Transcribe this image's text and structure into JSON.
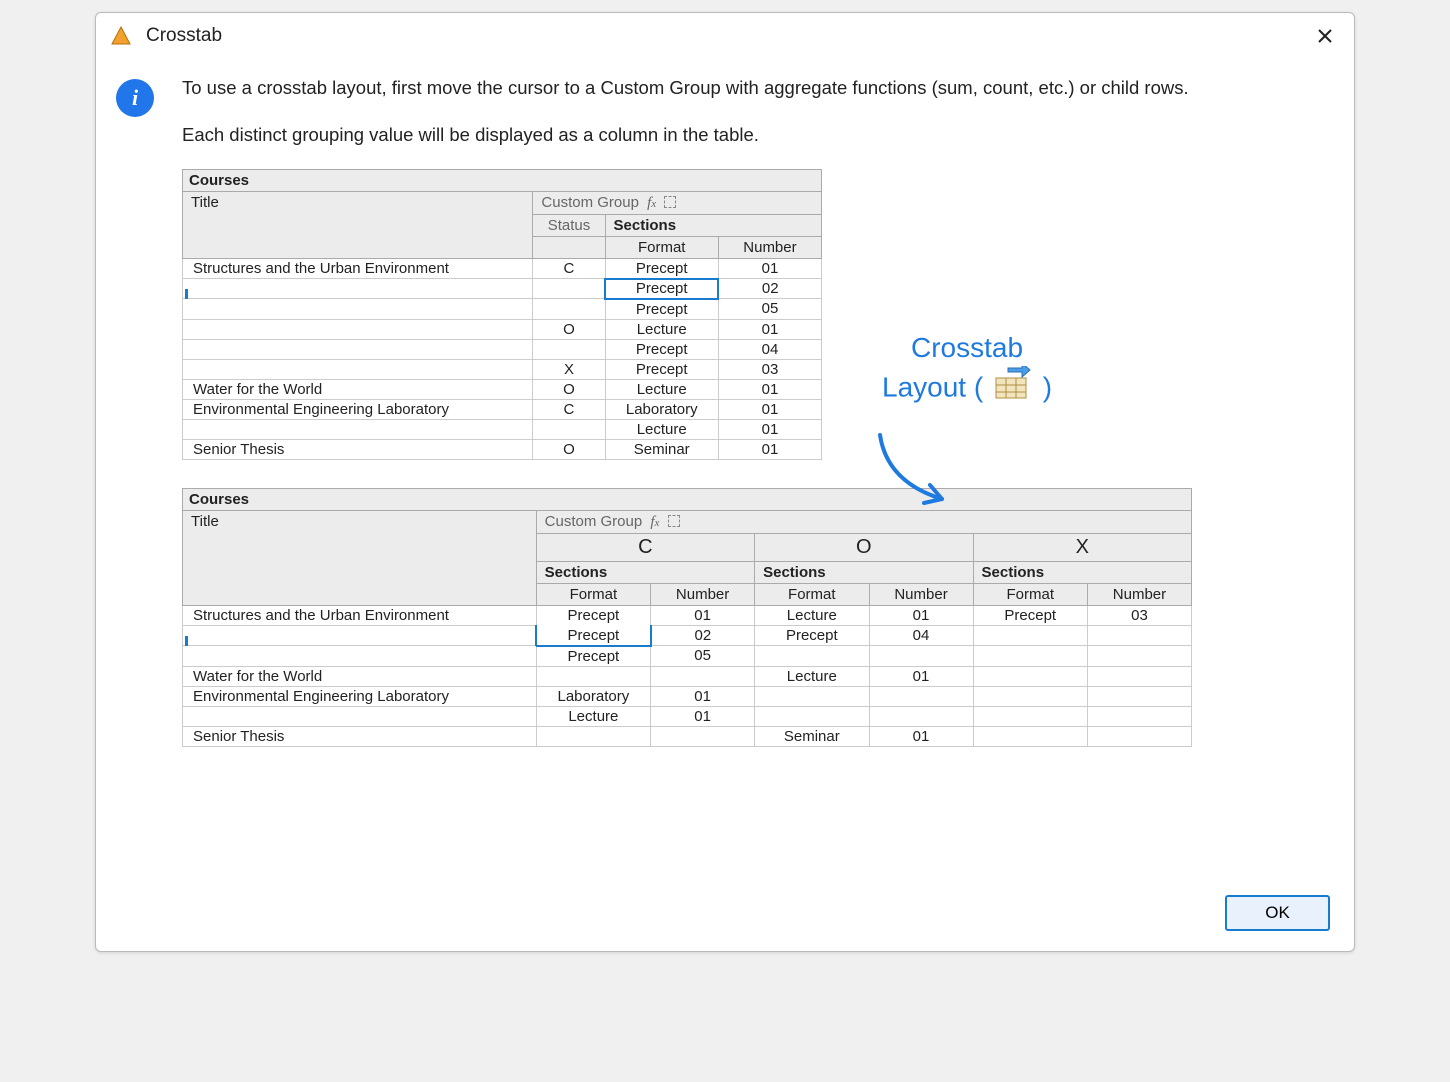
{
  "title": "Crosstab",
  "para1": "To use a crosstab layout, first move the cursor to a Custom Group with aggregate functions (sum, count, etc.) or child rows.",
  "para2": "Each distinct grouping value will be displayed as a column in the table.",
  "annotation": {
    "line1": "Crosstab",
    "line2_a": "Layout (",
    "line2_b": ")"
  },
  "ok_label": "OK",
  "table1": {
    "courses": "Courses",
    "title_hdr": "Title",
    "custom_group": "Custom Group",
    "status": "Status",
    "sections": "Sections",
    "format": "Format",
    "number": "Number",
    "rows": [
      {
        "title": "Structures and the Urban Environment",
        "status": "C",
        "format": "Precept",
        "number": "01"
      },
      {
        "title": "",
        "status": "",
        "format": "Precept",
        "number": "02",
        "sel": true
      },
      {
        "title": "",
        "status": "",
        "format": "Precept",
        "number": "05"
      },
      {
        "title": "",
        "status": "O",
        "format": "Lecture",
        "number": "01"
      },
      {
        "title": "",
        "status": "",
        "format": "Precept",
        "number": "04"
      },
      {
        "title": "",
        "status": "X",
        "format": "Precept",
        "number": "03"
      },
      {
        "title": "Water for the World",
        "status": "O",
        "format": "Lecture",
        "number": "01"
      },
      {
        "title": "Environmental Engineering Laboratory",
        "status": "C",
        "format": "Laboratory",
        "number": "01"
      },
      {
        "title": "",
        "status": "",
        "format": "Lecture",
        "number": "01"
      },
      {
        "title": "Senior Thesis",
        "status": "O",
        "format": "Seminar",
        "number": "01"
      }
    ]
  },
  "table2": {
    "courses": "Courses",
    "title_hdr": "Title",
    "custom_group": "Custom Group",
    "groups": [
      "C",
      "O",
      "X"
    ],
    "sections": "Sections",
    "format": "Format",
    "number": "Number",
    "rows": [
      {
        "title": "Structures and the Urban Environment",
        "c": [
          {
            "f": "Precept",
            "n": "01"
          },
          {
            "f": "Precept",
            "n": "02",
            "sel": true
          },
          {
            "f": "Precept",
            "n": "05"
          }
        ],
        "o": [
          {
            "f": "Lecture",
            "n": "01"
          },
          {
            "f": "Precept",
            "n": "04"
          }
        ],
        "x": [
          {
            "f": "Precept",
            "n": "03"
          }
        ]
      },
      {
        "title": "Water for the World",
        "c": [],
        "o": [
          {
            "f": "Lecture",
            "n": "01"
          }
        ],
        "x": []
      },
      {
        "title": "Environmental Engineering Laboratory",
        "c": [
          {
            "f": "Laboratory",
            "n": "01"
          },
          {
            "f": "Lecture",
            "n": "01"
          }
        ],
        "o": [],
        "x": []
      },
      {
        "title": "Senior Thesis",
        "c": [],
        "o": [
          {
            "f": "Seminar",
            "n": "01"
          }
        ],
        "x": []
      }
    ]
  }
}
